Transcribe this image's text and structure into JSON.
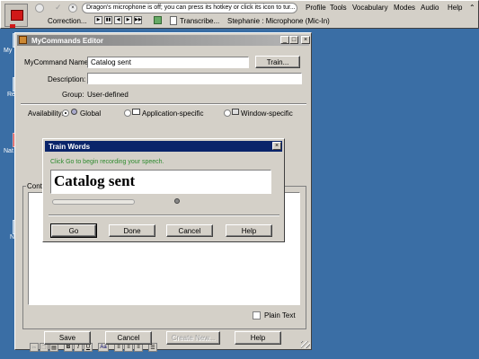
{
  "dragonbar": {
    "status_message": "Dragon's microphone is off; you can press its hotkey or click its icon to tur...",
    "correction_label": "Correction...",
    "transcribe_label": "Transcribe...",
    "profile_text": "Stephanie : Microphone (Mic-In)",
    "menu": [
      "Profile",
      "Tools",
      "Vocabulary",
      "Modes",
      "Audio",
      "Help"
    ],
    "collapse_glyph": "⌃"
  },
  "desktop": {
    "labels": [
      "My",
      "Re",
      "Nat",
      "N"
    ]
  },
  "editor": {
    "title": "MyCommands Editor",
    "command_name_label": "MyCommand Name:",
    "command_name_value": "Catalog sent",
    "train_button": "Train...",
    "description_label": "Description:",
    "description_value": "",
    "group_label": "Group:",
    "group_value": "User-defined",
    "availability_label": "Availability:",
    "availability_options": [
      "Global",
      "Application-specific",
      "Window-specific"
    ],
    "content_label": "Conte",
    "plain_text_label": "Plain Text",
    "format_buttons": [
      "B",
      "I",
      "U",
      "Aa"
    ],
    "buttons": {
      "save": "Save",
      "cancel": "Cancel",
      "create_new": "Create New...",
      "help": "Help"
    }
  },
  "train_dialog": {
    "title": "Train Words",
    "instruction": "Click Go to begin recording your speech.",
    "phrase": "Catalog sent",
    "progress": 0,
    "buttons": {
      "go": "Go",
      "done": "Done",
      "cancel": "Cancel",
      "help": "Help"
    }
  },
  "colors": {
    "desktop": "#3a6ea5",
    "active_title": "#0a246a",
    "inactive_title": "#808080",
    "instruction_text": "#2e8b2e"
  }
}
